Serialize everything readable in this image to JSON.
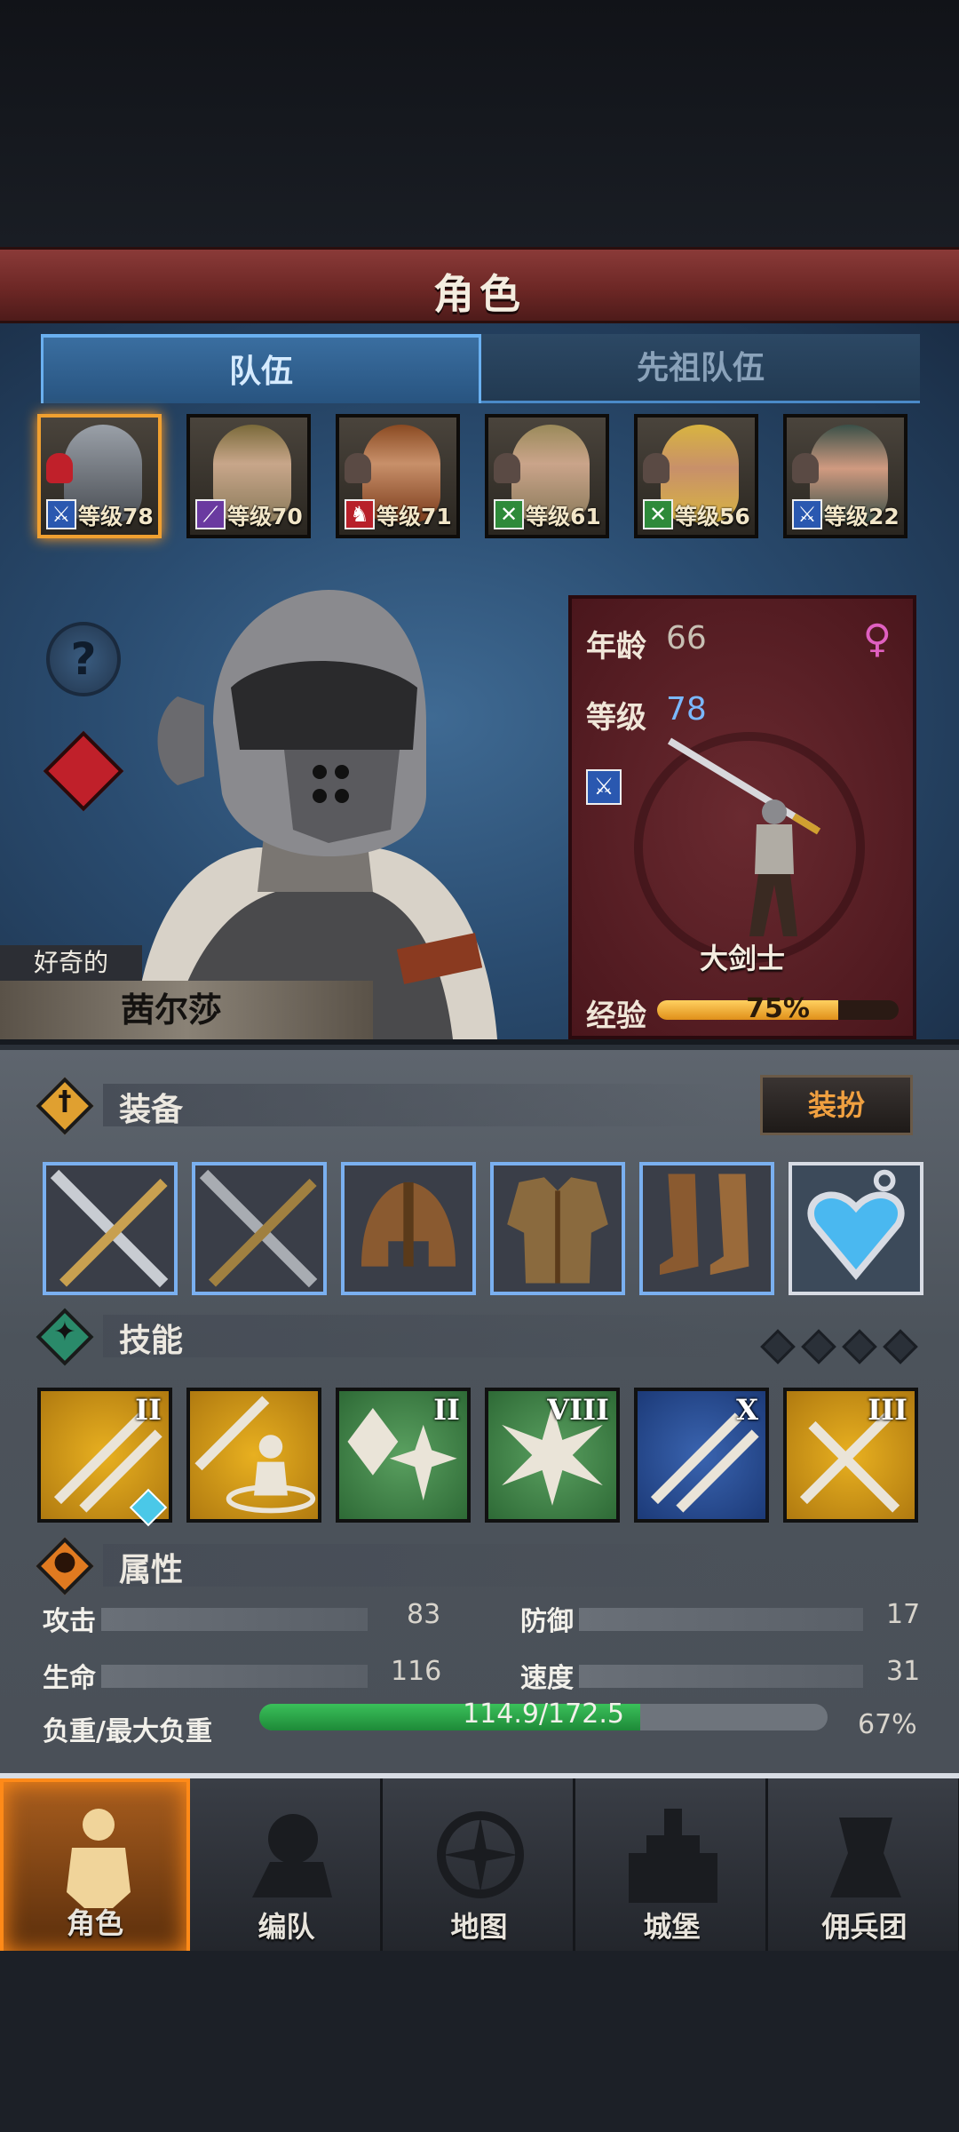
{
  "header": {
    "title": "角色"
  },
  "tabs": [
    {
      "label": "队伍",
      "active": true
    },
    {
      "label": "先祖队伍",
      "active": false
    }
  ],
  "roster": [
    {
      "level_text": "等级78",
      "class_icon": "sword-icon",
      "class_color": "#2a58b0",
      "selected": true
    },
    {
      "level_text": "等级70",
      "class_icon": "staff-icon",
      "class_color": "#6a3aa0",
      "selected": false
    },
    {
      "level_text": "等级71",
      "class_icon": "horse-icon",
      "class_color": "#b8202a",
      "selected": false
    },
    {
      "level_text": "等级61",
      "class_icon": "crossbow-icon",
      "class_color": "#2e8a3a",
      "selected": false
    },
    {
      "level_text": "等级56",
      "class_icon": "crossbow-icon",
      "class_color": "#2e8a3a",
      "selected": false
    },
    {
      "level_text": "等级22",
      "class_icon": "sword-icon",
      "class_color": "#2a58b0",
      "selected": false
    }
  ],
  "character": {
    "trait": "好奇的",
    "name": "茜尔莎",
    "age_label": "年龄",
    "age": "66",
    "level_label": "等级",
    "level": "78",
    "gender_icon": "female-icon",
    "class_icon": "sword-icon",
    "class_name": "大剑士",
    "xp_label": "经验",
    "xp_text": "75%",
    "xp_fraction": 0.75
  },
  "equipment": {
    "label": "装备",
    "dress_label": "装扮",
    "items": [
      {
        "icon": "greatsword-icon"
      },
      {
        "icon": "greatsword-icon"
      },
      {
        "icon": "helmet-icon"
      },
      {
        "icon": "armor-icon"
      },
      {
        "icon": "boots-icon"
      },
      {
        "icon": "amulet-icon"
      }
    ]
  },
  "skills": {
    "label": "技能",
    "items": [
      {
        "rank": "II",
        "color": "gold",
        "gem": "1"
      },
      {
        "rank": "",
        "color": "gold"
      },
      {
        "rank": "II",
        "color": "green"
      },
      {
        "rank": "VIII",
        "color": "green"
      },
      {
        "rank": "X",
        "color": "blue"
      },
      {
        "rank": "III",
        "color": "gold"
      }
    ],
    "empty_slots": 4
  },
  "attributes": {
    "label": "属性",
    "attack_label": "攻击",
    "attack": "83",
    "defense_label": "防御",
    "defense": "17",
    "hp_label": "生命",
    "hp": "116",
    "speed_label": "速度",
    "speed": "31",
    "load_label": "负重/最大负重",
    "load_text": "114.9/172.5",
    "load_pct": "67%",
    "load_fraction": 0.67
  },
  "nav": [
    {
      "label": "角色",
      "icon": "knight-icon",
      "active": true
    },
    {
      "label": "编队",
      "icon": "formation-icon",
      "active": false
    },
    {
      "label": "地图",
      "icon": "compass-icon",
      "active": false
    },
    {
      "label": "城堡",
      "icon": "castle-icon",
      "active": false
    },
    {
      "label": "佣兵团",
      "icon": "mercenary-icon",
      "active": false
    }
  ]
}
